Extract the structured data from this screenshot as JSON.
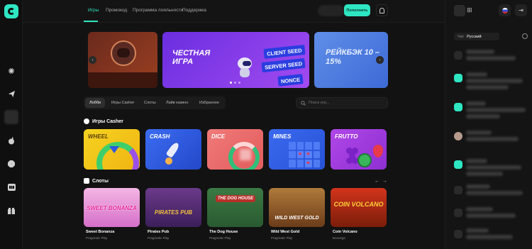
{
  "topnav": {
    "tabs": [
      {
        "label": "Игры",
        "active": true
      },
      {
        "label": "Промокод",
        "active": false
      },
      {
        "label": "Программа лояльности",
        "active": false
      },
      {
        "label": "Поддержка",
        "active": false
      }
    ],
    "deposit_label": "Пополнить"
  },
  "banners": {
    "main_title": "ЧЕСТНАЯ ИГРА",
    "seed_badges": [
      "CLIENT SEED",
      "SERVER SEED",
      "NONCE"
    ],
    "cashback_title": "РЕЙКБЭК 10 – 15%"
  },
  "filters": {
    "tabs": [
      {
        "label": "Лобби",
        "active": true
      },
      {
        "label": "Игры Casher",
        "active": false
      },
      {
        "label": "Слоты",
        "active": false
      },
      {
        "label": "Лайв казино",
        "active": false
      },
      {
        "label": "Избранное",
        "active": false
      }
    ],
    "search_placeholder": "Поиск игр..."
  },
  "casher_section": {
    "title": "Игры Casher",
    "games": [
      "WHEEL",
      "CRASH",
      "DICE",
      "MINES",
      "FRUTTO"
    ]
  },
  "slots_section": {
    "title": "Слоты",
    "games": [
      {
        "name": "Sweet Bonanza",
        "provider": "Pragmatic Play",
        "logo": "SWEET BONANZA"
      },
      {
        "name": "Pirates Pub",
        "provider": "Pragmatic Play",
        "logo": "PIRATES PUB"
      },
      {
        "name": "The Dog House",
        "provider": "Pragmatic Play",
        "logo": "THE DOG HOUSE"
      },
      {
        "name": "Wild West Gold",
        "provider": "Pragmatic Play",
        "logo": "WILD WEST GOLD"
      },
      {
        "name": "Coin Volcano",
        "provider": "Booongo",
        "logo": "COIN VOLCANO"
      }
    ]
  },
  "chat": {
    "label": "Чат",
    "language": "Русский"
  },
  "icons": {
    "rail": [
      "logo-icon",
      "pinwheel-icon",
      "telegram-icon",
      "bomb-icon",
      "gem-icon",
      "slots-777-icon",
      "gift-icon"
    ]
  },
  "colors": {
    "accent": "#2ee6c2",
    "background": "#121212"
  }
}
